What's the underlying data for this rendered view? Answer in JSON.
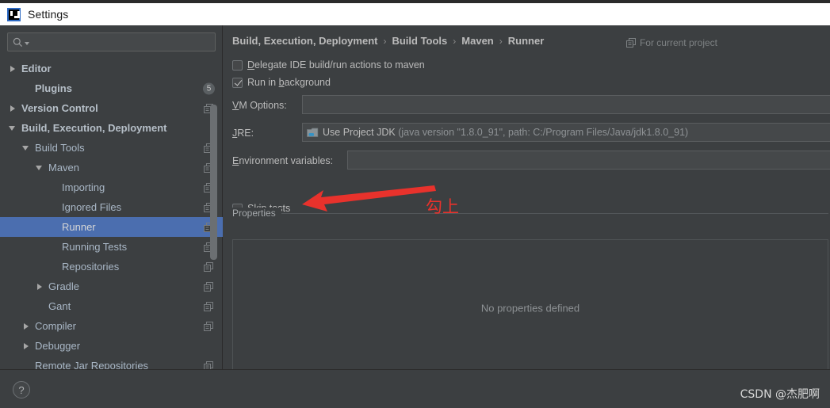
{
  "window": {
    "title": "Settings",
    "logo_icon": "intellij-idea-logo-icon"
  },
  "sidebar": {
    "search": {
      "placeholder": "",
      "value": "",
      "icon": "search-icon"
    },
    "items": [
      {
        "label": "Editor",
        "indent": 0,
        "arrow": "right",
        "bold": true,
        "copy": false,
        "badge": ""
      },
      {
        "label": "Plugins",
        "indent": 1,
        "arrow": "none",
        "bold": true,
        "copy": false,
        "badge": "5"
      },
      {
        "label": "Version Control",
        "indent": 0,
        "arrow": "right",
        "bold": true,
        "copy": true,
        "badge": ""
      },
      {
        "label": "Build, Execution, Deployment",
        "indent": 0,
        "arrow": "down",
        "bold": true,
        "copy": false,
        "badge": ""
      },
      {
        "label": "Build Tools",
        "indent": 1,
        "arrow": "down",
        "bold": false,
        "copy": true,
        "badge": ""
      },
      {
        "label": "Maven",
        "indent": 2,
        "arrow": "down",
        "bold": false,
        "copy": true,
        "badge": ""
      },
      {
        "label": "Importing",
        "indent": 3,
        "arrow": "none",
        "bold": false,
        "copy": true,
        "badge": ""
      },
      {
        "label": "Ignored Files",
        "indent": 3,
        "arrow": "none",
        "bold": false,
        "copy": true,
        "badge": ""
      },
      {
        "label": "Runner",
        "indent": 3,
        "arrow": "none",
        "bold": false,
        "copy": true,
        "badge": "",
        "selected": true
      },
      {
        "label": "Running Tests",
        "indent": 3,
        "arrow": "none",
        "bold": false,
        "copy": true,
        "badge": ""
      },
      {
        "label": "Repositories",
        "indent": 3,
        "arrow": "none",
        "bold": false,
        "copy": true,
        "badge": ""
      },
      {
        "label": "Gradle",
        "indent": 2,
        "arrow": "right",
        "bold": false,
        "copy": true,
        "badge": ""
      },
      {
        "label": "Gant",
        "indent": 2,
        "arrow": "none",
        "bold": false,
        "copy": true,
        "badge": ""
      },
      {
        "label": "Compiler",
        "indent": 1,
        "arrow": "right",
        "bold": false,
        "copy": true,
        "badge": ""
      },
      {
        "label": "Debugger",
        "indent": 1,
        "arrow": "right",
        "bold": false,
        "copy": false,
        "badge": ""
      },
      {
        "label": "Remote Jar Repositories",
        "indent": 1,
        "arrow": "none",
        "bold": false,
        "copy": true,
        "badge": ""
      }
    ]
  },
  "main": {
    "breadcrumb": [
      "Build, Execution, Deployment",
      "Build Tools",
      "Maven",
      "Runner"
    ],
    "breadcrumb_separator": "›",
    "for_current_project": "For current project",
    "for_current_project_icon": "copy-icon",
    "checkboxes": [
      {
        "label_pre": "",
        "label_underline": "D",
        "label_post": "elegate IDE build/run actions to maven",
        "checked": false
      },
      {
        "label_pre": "Run in ",
        "label_underline": "b",
        "label_post": "ackground",
        "checked": true
      }
    ],
    "vm_options": {
      "label_underline": "V",
      "label_pre": "",
      "label_post": "M Options:",
      "value": ""
    },
    "jre": {
      "label_underline": "J",
      "label_pre": "",
      "label_post": "RE:",
      "value": "Use Project JDK",
      "value_detail": "(java version \"1.8.0_91\", path: C:/Program Files/Java/jdk1.8.0_91)",
      "icon": "folder-icon"
    },
    "environment_variables": {
      "label_underline": "E",
      "label_pre": "",
      "label_post": "nvironment variables:",
      "value": ""
    },
    "properties_section": {
      "title": "Properties",
      "skip_tests": {
        "label_pre": "Skip ",
        "label_underline": "t",
        "label_post": "ests",
        "checked": false
      },
      "empty_message": "No properties defined"
    }
  },
  "annotation": {
    "text": "勾上",
    "color": "#e8322c",
    "arrow_icon": "red-arrow-icon"
  },
  "footer": {
    "help_label": "?",
    "help_icon": "help-icon",
    "watermark": "CSDN @杰肥啊"
  },
  "colors": {
    "background": "#3c3f41",
    "selection": "#4b6eaf",
    "text": "#bbbbbb",
    "accent_red": "#e8322c"
  }
}
